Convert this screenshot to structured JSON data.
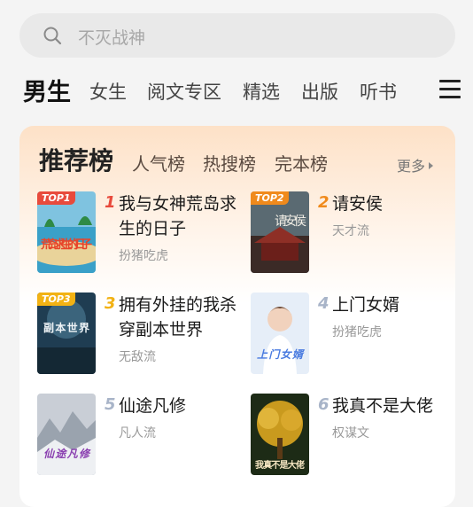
{
  "search": {
    "placeholder": "不灭战神"
  },
  "channel_tabs": [
    {
      "label": "男生",
      "active": true
    },
    {
      "label": "女生"
    },
    {
      "label": "阅文专区"
    },
    {
      "label": "精选"
    },
    {
      "label": "出版"
    },
    {
      "label": "听书"
    }
  ],
  "ranking": {
    "tabs": [
      {
        "label": "推荐榜",
        "active": true
      },
      {
        "label": "人气榜"
      },
      {
        "label": "热搜榜"
      },
      {
        "label": "完本榜"
      }
    ],
    "more_label": "更多",
    "books": [
      {
        "rank": "1",
        "badge": "TOP1",
        "title": "我与女神荒岛求生的日子",
        "author": "扮猪吃虎",
        "cover_text": "荒岛求生的日子"
      },
      {
        "rank": "2",
        "badge": "TOP2",
        "title": "请安侯",
        "author": "天才流",
        "cover_text": "请安侯"
      },
      {
        "rank": "3",
        "badge": "TOP3",
        "title": "拥有外挂的我杀穿副本世界",
        "author": "无敌流",
        "cover_text": "副本世界"
      },
      {
        "rank": "4",
        "title": "上门女婿",
        "author": "扮猪吃虎",
        "cover_text": "上门女婿"
      },
      {
        "rank": "5",
        "title": "仙途凡修",
        "author": "凡人流",
        "cover_text": "仙途凡修"
      },
      {
        "rank": "6",
        "title": "我真不是大佬",
        "author": "权谋文",
        "cover_text": "我真不是大佬"
      }
    ]
  },
  "colors": {
    "rank1": "#e84a3c",
    "rank2": "#f08a1c",
    "rank3": "#f2b214",
    "rank_other": "#a8b4c8"
  }
}
